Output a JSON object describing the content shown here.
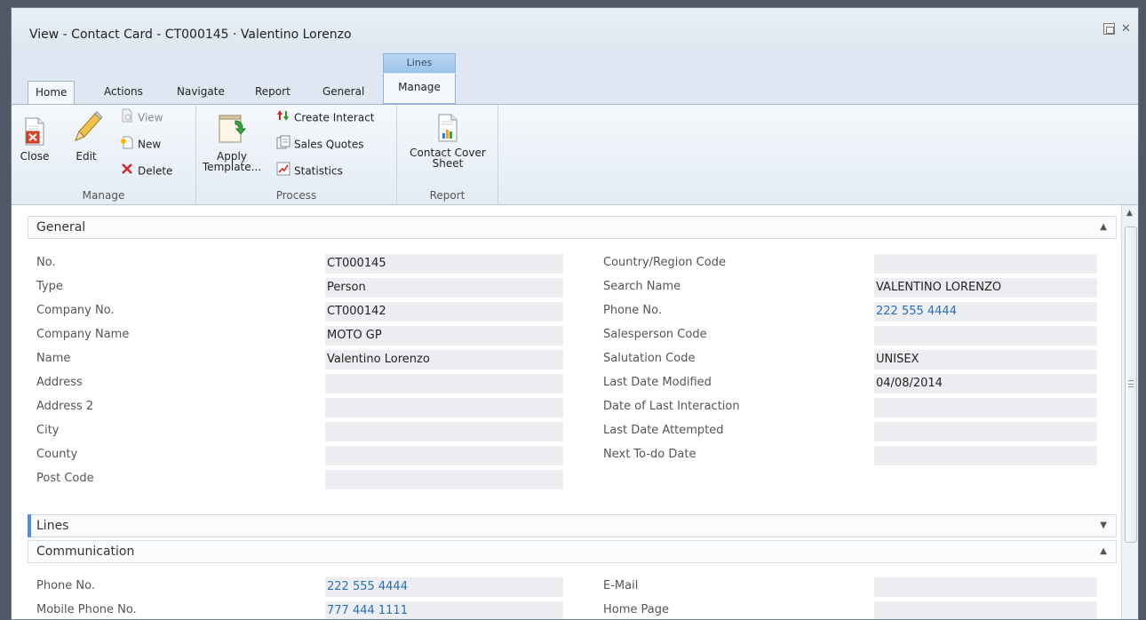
{
  "window": {
    "title": "View - Contact Card - CT000145 · Valentino Lorenzo",
    "restore_label": "",
    "close_label": "✕"
  },
  "ribbon_tabs": {
    "context_header": "Lines",
    "home": "Home",
    "actions": "Actions",
    "navigate": "Navigate",
    "report": "Report",
    "general": "General",
    "manage": "Manage"
  },
  "ribbon": {
    "manage_group": {
      "label": "Manage",
      "close": "Close",
      "edit": "Edit",
      "view": "View",
      "new": "New",
      "delete": "Delete"
    },
    "process_group": {
      "label": "Process",
      "apply_line1": "Apply",
      "apply_line2": "Template...",
      "create_interact": "Create Interact",
      "sales_quotes": "Sales Quotes",
      "statistics": "Statistics"
    },
    "report_group": {
      "label": "Report",
      "cover_line1": "Contact Cover",
      "cover_line2": "Sheet"
    }
  },
  "sections": {
    "general": "General",
    "lines": "Lines",
    "communication": "Communication"
  },
  "general_left": [
    {
      "label": "No.",
      "value": "CT000145"
    },
    {
      "label": "Type",
      "value": "Person"
    },
    {
      "label": "Company No.",
      "value": "CT000142"
    },
    {
      "label": "Company Name",
      "value": "MOTO GP"
    },
    {
      "label": "Name",
      "value": "Valentino Lorenzo"
    },
    {
      "label": "Address",
      "value": ""
    },
    {
      "label": "Address 2",
      "value": ""
    },
    {
      "label": "City",
      "value": ""
    },
    {
      "label": "County",
      "value": ""
    },
    {
      "label": "Post Code",
      "value": ""
    }
  ],
  "general_right": [
    {
      "label": "Country/Region Code",
      "value": ""
    },
    {
      "label": "Search Name",
      "value": "VALENTINO LORENZO"
    },
    {
      "label": "Phone No.",
      "value": "222 555 4444"
    },
    {
      "label": "Salesperson Code",
      "value": ""
    },
    {
      "label": "Salutation Code",
      "value": "UNISEX"
    },
    {
      "label": "Last Date Modified",
      "value": "04/08/2014"
    },
    {
      "label": "Date of Last Interaction",
      "value": ""
    },
    {
      "label": "Last Date Attempted",
      "value": ""
    },
    {
      "label": "Next To-do Date",
      "value": ""
    }
  ],
  "communication_left": [
    {
      "label": "Phone No.",
      "value": "222 555 4444"
    },
    {
      "label": "Mobile Phone No.",
      "value": "777 444 1111"
    }
  ],
  "communication_right": [
    {
      "label": "E-Mail",
      "value": ""
    },
    {
      "label": "Home Page",
      "value": ""
    }
  ],
  "colors": {
    "link": "#2a6fba",
    "context_tab": "#9cc4ec",
    "lines_marker": "#4a8fd8"
  }
}
